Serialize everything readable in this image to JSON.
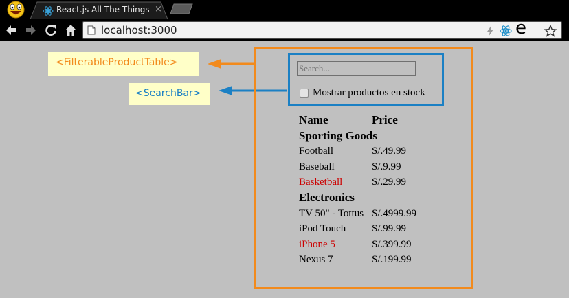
{
  "browser": {
    "tab": {
      "title": "React.js All The Things",
      "close_glyph": "×"
    },
    "url": "localhost:3000",
    "extension_letter": "e",
    "icons": [
      "app-logo-icon",
      "react-favicon-icon",
      "back-icon",
      "forward-icon",
      "reload-icon",
      "home-icon",
      "page-icon",
      "lightning-icon",
      "react-extension-icon",
      "star-icon"
    ]
  },
  "annotations": {
    "filterable_product_table": "<FilterableProductTable>",
    "search_bar": "<SearchBar>",
    "colors": {
      "filterable_product_table": "#f28a1c",
      "search_bar": "#1b80c4",
      "label_background": "#ffffc8"
    }
  },
  "search_bar": {
    "placeholder": "Search...",
    "value": "",
    "in_stock_label": "Mostrar productos en stock",
    "in_stock_checked": false
  },
  "product_table": {
    "headers": {
      "name": "Name",
      "price": "Price"
    },
    "categories": [
      {
        "name": "Sporting Goods",
        "products": [
          {
            "name": "Football",
            "price": "S/.49.99",
            "in_stock": true
          },
          {
            "name": "Baseball",
            "price": "S/.9.99",
            "in_stock": true
          },
          {
            "name": "Basketball",
            "price": "S/.29.99",
            "in_stock": false
          }
        ]
      },
      {
        "name": "Electronics",
        "products": [
          {
            "name": "TV 50\" - Tottus",
            "price": "S/.4999.99",
            "in_stock": true
          },
          {
            "name": "iPod Touch",
            "price": "S/.99.99",
            "in_stock": true
          },
          {
            "name": "iPhone 5",
            "price": "S/.399.99",
            "in_stock": false
          },
          {
            "name": "Nexus 7",
            "price": "S/.199.99",
            "in_stock": true
          }
        ]
      }
    ],
    "out_of_stock_color": "#cc0000"
  }
}
